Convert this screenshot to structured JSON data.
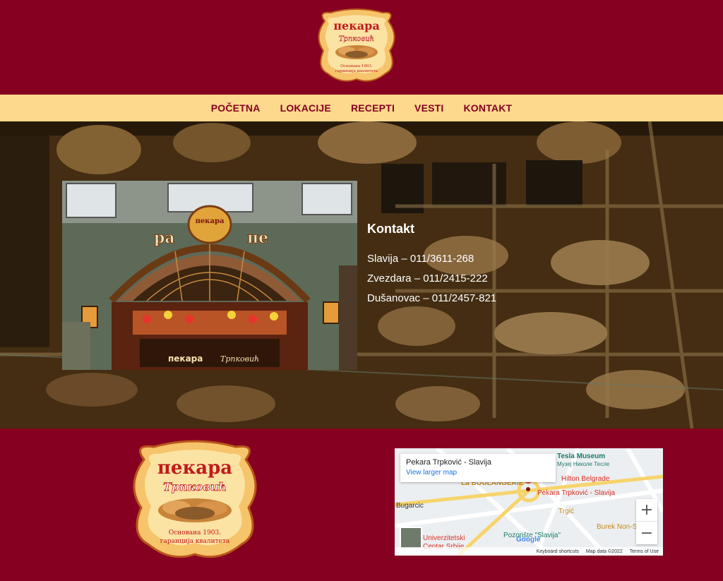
{
  "brand": {
    "logo_line1": "пекара",
    "logo_line2": "Трпковић",
    "logo_tag1": "Основана 1903.",
    "logo_tag2": "гаранција квалитета"
  },
  "nav": {
    "items": [
      "POČETNA",
      "LOKACIJE",
      "RECEPTI",
      "VESTI",
      "KONTAKT"
    ]
  },
  "contact": {
    "title": "Kontakt",
    "lines": [
      "Slavija – 011/3611-268",
      "Zvezdara – 011/2415-222",
      "Dušanovac – 011/2457-821"
    ]
  },
  "map": {
    "place_name": "Pekara Trpković - Slavija",
    "larger_map_link": "View larger map",
    "zoom_in": "+",
    "zoom_out": "−",
    "labels": {
      "tesla": "Tesla Museum",
      "tesla_sub": "Музеј Николе Тесле",
      "hilton": "Hilton Belgrade",
      "boulangerie": "La BOULANGERIE",
      "pin_label": "Pekara Trpković - Slavija",
      "bugarcic": "Bugarcic",
      "trgic": "Trgić",
      "pozoriste": "Pozorište \"Slavija\"",
      "burek": "Burek Non-S",
      "univerzitet1": "Univerzitetski",
      "univerzitet2": "Centar Srbije",
      "google": "Google"
    },
    "footer": [
      "Keyboard shortcuts",
      "Map data ©2022",
      "Terms of Use"
    ]
  },
  "colors": {
    "brand_red": "#860021",
    "nav_cream": "#fdd98d",
    "logo_gold": "#e3a72f"
  }
}
